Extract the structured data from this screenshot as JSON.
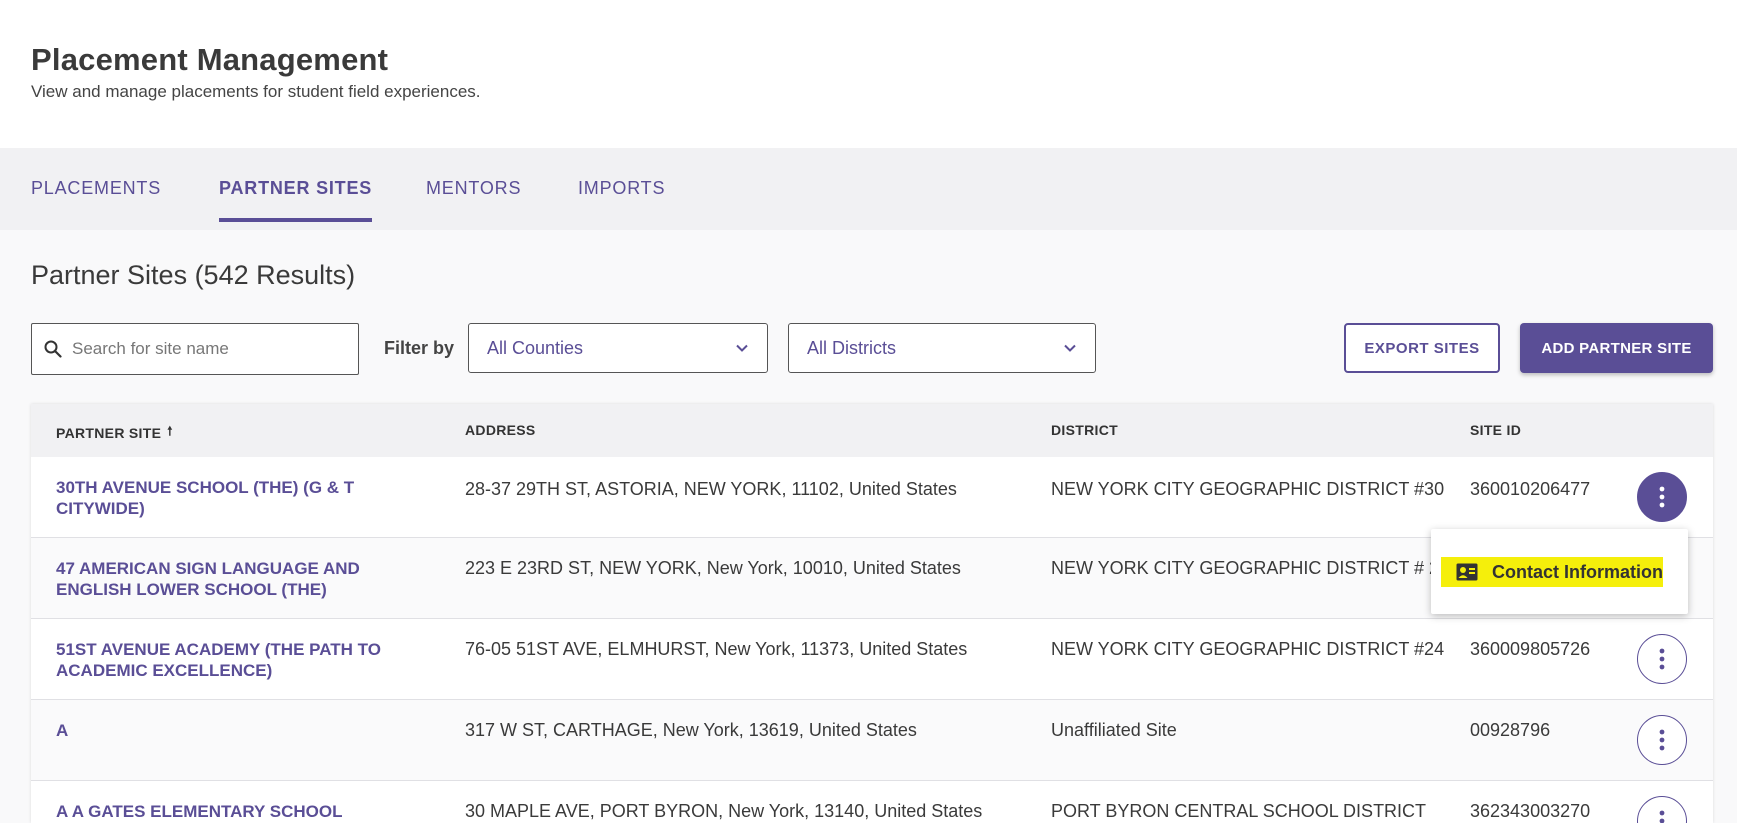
{
  "header": {
    "title": "Placement Management",
    "subtitle": "View and manage placements for student field experiences."
  },
  "tabs": [
    {
      "label": "PLACEMENTS",
      "active": false
    },
    {
      "label": "PARTNER SITES",
      "active": true
    },
    {
      "label": "MENTORS",
      "active": false
    },
    {
      "label": "IMPORTS",
      "active": false
    }
  ],
  "section": {
    "title": "Partner Sites (542 Results)"
  },
  "toolbar": {
    "search_placeholder": "Search for site name",
    "search_value": "",
    "filter_label": "Filter by",
    "county_select": "All Counties",
    "district_select": "All Districts",
    "export_label": "EXPORT SITES",
    "add_label": "ADD PARTNER SITE"
  },
  "table": {
    "columns": [
      "PARTNER SITE",
      "ADDRESS",
      "DISTRICT",
      "SITE ID"
    ],
    "sort_indicator": "🠕",
    "rows": [
      {
        "site": "30TH AVENUE SCHOOL (THE) (G & T CITYWIDE)",
        "address": "28-37 29TH ST, ASTORIA, NEW YORK, 11102, United States",
        "district": "NEW YORK CITY GEOGRAPHIC DISTRICT #30",
        "site_id": "360010206477"
      },
      {
        "site": "47 AMERICAN SIGN LANGUAGE AND ENGLISH LOWER SCHOOL (THE)",
        "address": "223 E 23RD ST, NEW YORK, New York, 10010, United States",
        "district": "NEW YORK CITY GEOGRAPHIC DISTRICT # 2",
        "site_id": ""
      },
      {
        "site": "51ST AVENUE ACADEMY (THE PATH TO ACADEMIC EXCELLENCE)",
        "address": "76-05 51ST AVE, ELMHURST, New York, 11373, United States",
        "district": "NEW YORK CITY GEOGRAPHIC DISTRICT #24",
        "site_id": "360009805726"
      },
      {
        "site": "A",
        "address": "317 W ST, CARTHAGE, New York, 13619, United States",
        "district": "Unaffiliated Site",
        "site_id": "00928796"
      },
      {
        "site": "A A GATES ELEMENTARY SCHOOL",
        "address": "30 MAPLE AVE, PORT BYRON, New York, 13140, United States",
        "district": "PORT BYRON CENTRAL SCHOOL DISTRICT",
        "site_id": "362343003270"
      }
    ]
  },
  "row_menu": {
    "items": [
      {
        "label": "Contact Information",
        "icon": "contact-card-icon",
        "highlighted": true
      }
    ]
  },
  "colors": {
    "accent": "#5a4e96",
    "highlight": "#f5ef0b"
  }
}
